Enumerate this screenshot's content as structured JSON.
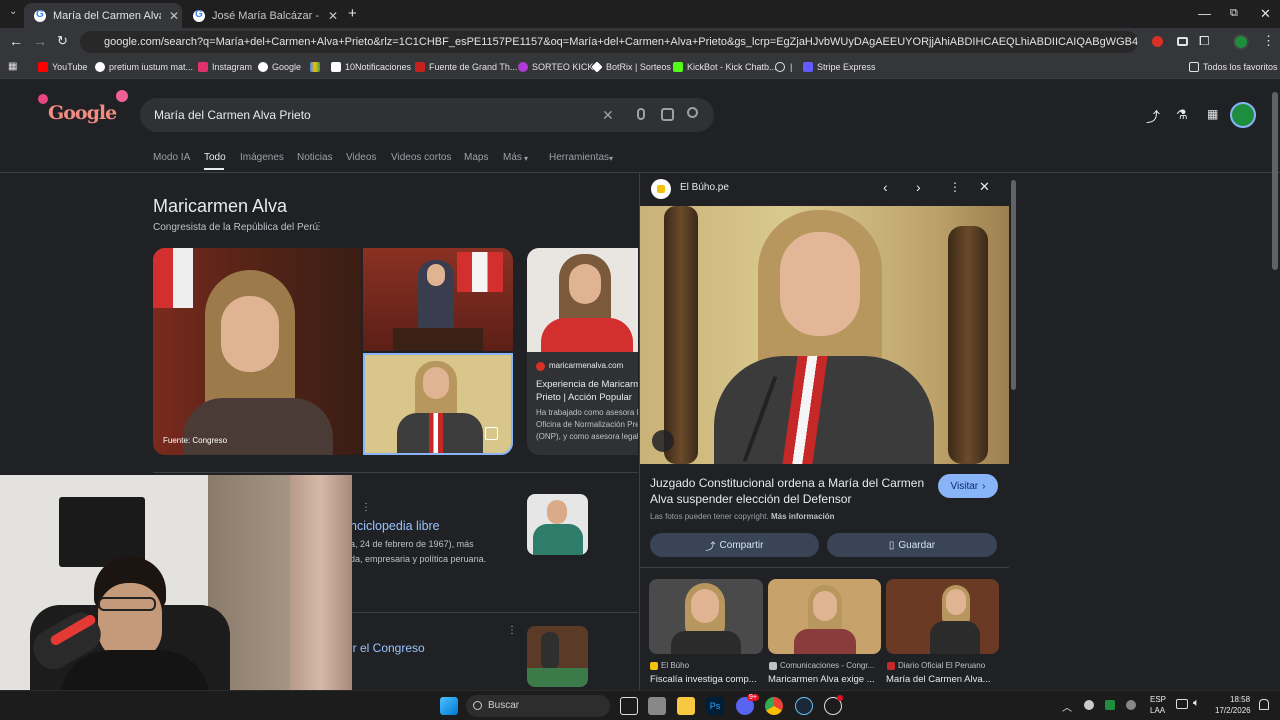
{
  "browser": {
    "tabs": [
      {
        "label": "María del Carmen Alva Prieto",
        "close": "✕"
      },
      {
        "label": "José María Balcázar - Buscar co",
        "close": "✕"
      }
    ],
    "new_tab": "+",
    "url": "google.com/search?q=María+del+Carmen+Alva+Prieto&rlz=1C1CHBF_esPE1157PE1157&oq=María+del+Carmen+Alva+Prieto&gs_lcrp=EgZjaHJvbWUyDAgAEEUYORjjAhiABDIHCAEQLhiABDIICAIQABgWGB4yBwgDEAAY7wUyBwgEEAAY7wUyB...",
    "bookmarks": [
      "YouTube",
      "pretium iustum mat...",
      "Instagram",
      "Google",
      "10Notificaciones",
      "Fuente de Grand Th...",
      "SORTEO KICK",
      "BotRix | Sorteos",
      "KickBot - Kick Chatb...",
      "Stripe Express"
    ],
    "all_favorites": "Todos los favoritos",
    "divider": "|"
  },
  "search": {
    "query": "María del Carmen Alva Prieto",
    "logo": "Google",
    "tabs": [
      "Modo IA",
      "Todo",
      "Imágenes",
      "Noticias",
      "Videos",
      "Videos cortos",
      "Maps",
      "Más",
      "Herramientas"
    ]
  },
  "knowledge": {
    "name": "Maricarmen Alva",
    "subtitle": "Congresista de la República del Perú",
    "photo_credit": "Fuente: Congreso",
    "card_site": "maricarmenalva.com",
    "card_title": "Experiencia de Maricarmen Alva Prieto | Acción Popular",
    "card_snippet": "Ha trabajado como asesora legal en la Oficina de Normalización Previsional (ONP), y como asesora legal",
    "result1_title": "nciclopedia libre",
    "result1_snippet_1": "a, 24 de febrero de 1967), más",
    "result1_snippet_2": "da, empresaria y política peruana.",
    "result2_title": "ir el Congreso"
  },
  "panel": {
    "source": "El Búho.pe",
    "headline": "Juzgado Constitucional ordena a María del Carmen Alva suspender elección del Defensor",
    "visit": "Visitar",
    "copyright": "Las fotos pueden tener copyright.",
    "more_info": "Más información",
    "share": "Compartir",
    "save": "Guardar",
    "related": [
      {
        "source": "El Búho",
        "title": "Fiscalía investiga comp..."
      },
      {
        "source": "Comunicaciones - Congr...",
        "title": "Maricarmen Alva exige ..."
      },
      {
        "source": "Diario Oficial El Peruano",
        "title": "María del Carmen Alva..."
      }
    ]
  },
  "taskbar": {
    "search": "Buscar",
    "lang_1": "ESP",
    "lang_2": "LAA",
    "time": "18:58",
    "date": "17/2/2026",
    "discord_badge": "9+"
  },
  "colors": {
    "accent": "#8ab4f8",
    "panel_button": "#394457",
    "visit_button": "#8ab4f8"
  }
}
